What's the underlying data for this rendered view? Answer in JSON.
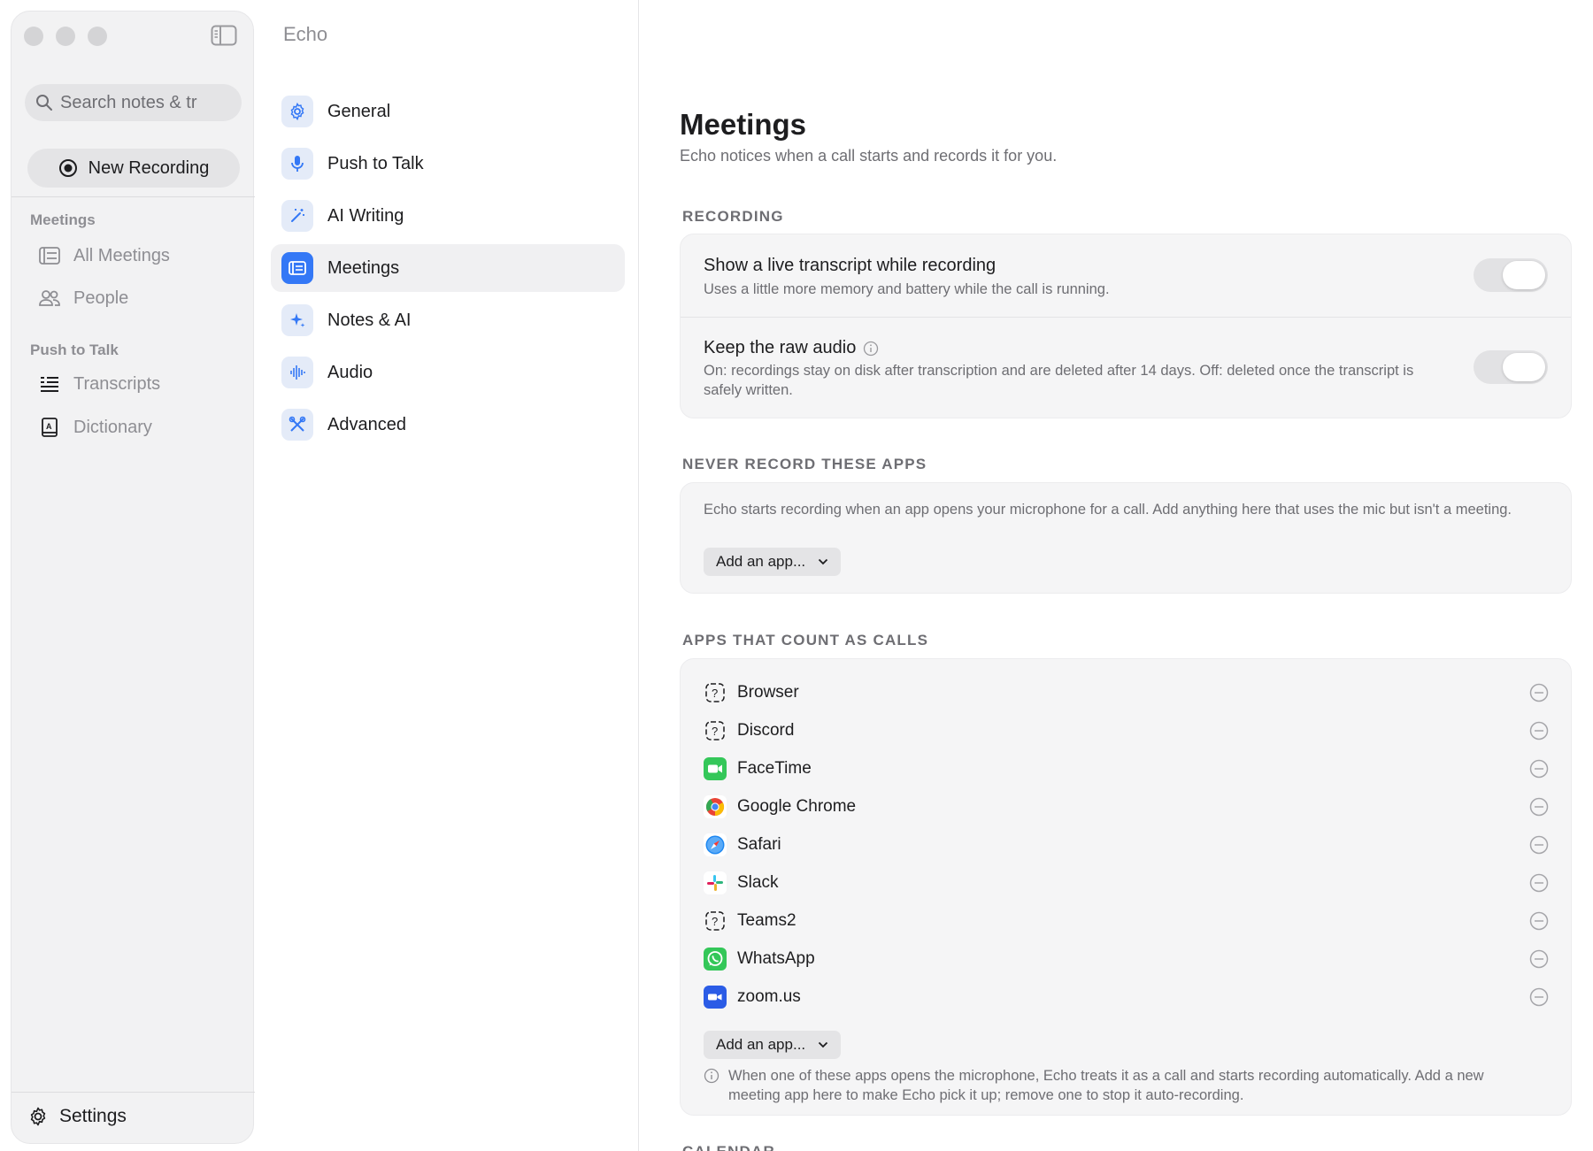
{
  "sidebar": {
    "search_placeholder": "Search notes & tr",
    "new_recording": "New Recording",
    "sections": [
      {
        "title": "Meetings",
        "items": [
          {
            "label": "All Meetings",
            "icon": "list-icon"
          },
          {
            "label": "People",
            "icon": "people-icon"
          }
        ]
      },
      {
        "title": "Push to Talk",
        "items": [
          {
            "label": "Transcripts",
            "icon": "transcripts-icon"
          },
          {
            "label": "Dictionary",
            "icon": "dictionary-icon"
          }
        ]
      }
    ],
    "settings": "Settings"
  },
  "nav": {
    "title": "Echo",
    "items": [
      {
        "label": "General",
        "icon": "gear-icon"
      },
      {
        "label": "Push to Talk",
        "icon": "microphone-icon"
      },
      {
        "label": "AI Writing",
        "icon": "magic-wand-icon"
      },
      {
        "label": "Meetings",
        "icon": "meetings-icon",
        "active": true
      },
      {
        "label": "Notes & AI",
        "icon": "sparkle-icon"
      },
      {
        "label": "Audio",
        "icon": "waveform-icon"
      },
      {
        "label": "Advanced",
        "icon": "tools-icon"
      }
    ],
    "accent": "#3478f6"
  },
  "content": {
    "title": "Meetings",
    "subtitle": "Echo notices when a call starts and records it for you.",
    "recording": {
      "label": "RECORDING",
      "live_transcript": {
        "title": "Show a live transcript while recording",
        "desc": "Uses a little more memory and battery while the call is running.",
        "enabled": false
      },
      "raw_audio": {
        "title": "Keep the raw audio",
        "desc": "On: recordings stay on disk after transcription and are deleted after 14 days. Off: deleted once the transcript is safely written.",
        "enabled": false
      }
    },
    "never_record": {
      "label": "NEVER RECORD THESE APPS",
      "desc": "Echo starts recording when an app opens your microphone for a call. Add anything here that uses the mic but isn't a meeting.",
      "add_label": "Add an app..."
    },
    "call_apps": {
      "label": "APPS THAT COUNT AS CALLS",
      "apps": [
        {
          "name": "Browser",
          "icon": "unknown-app-icon"
        },
        {
          "name": "Discord",
          "icon": "unknown-app-icon"
        },
        {
          "name": "FaceTime",
          "icon": "facetime-icon"
        },
        {
          "name": "Google Chrome",
          "icon": "chrome-icon"
        },
        {
          "name": "Safari",
          "icon": "safari-icon"
        },
        {
          "name": "Slack",
          "icon": "slack-icon"
        },
        {
          "name": "Teams2",
          "icon": "unknown-app-icon"
        },
        {
          "name": "WhatsApp",
          "icon": "whatsapp-icon"
        },
        {
          "name": "zoom.us",
          "icon": "zoom-icon"
        }
      ],
      "add_label": "Add an app...",
      "footnote": "When one of these apps opens the microphone, Echo treats it as a call and starts recording automatically. Add a new meeting app here to make Echo pick it up; remove one to stop it auto-recording."
    },
    "calendar_label": "CALENDAR"
  }
}
